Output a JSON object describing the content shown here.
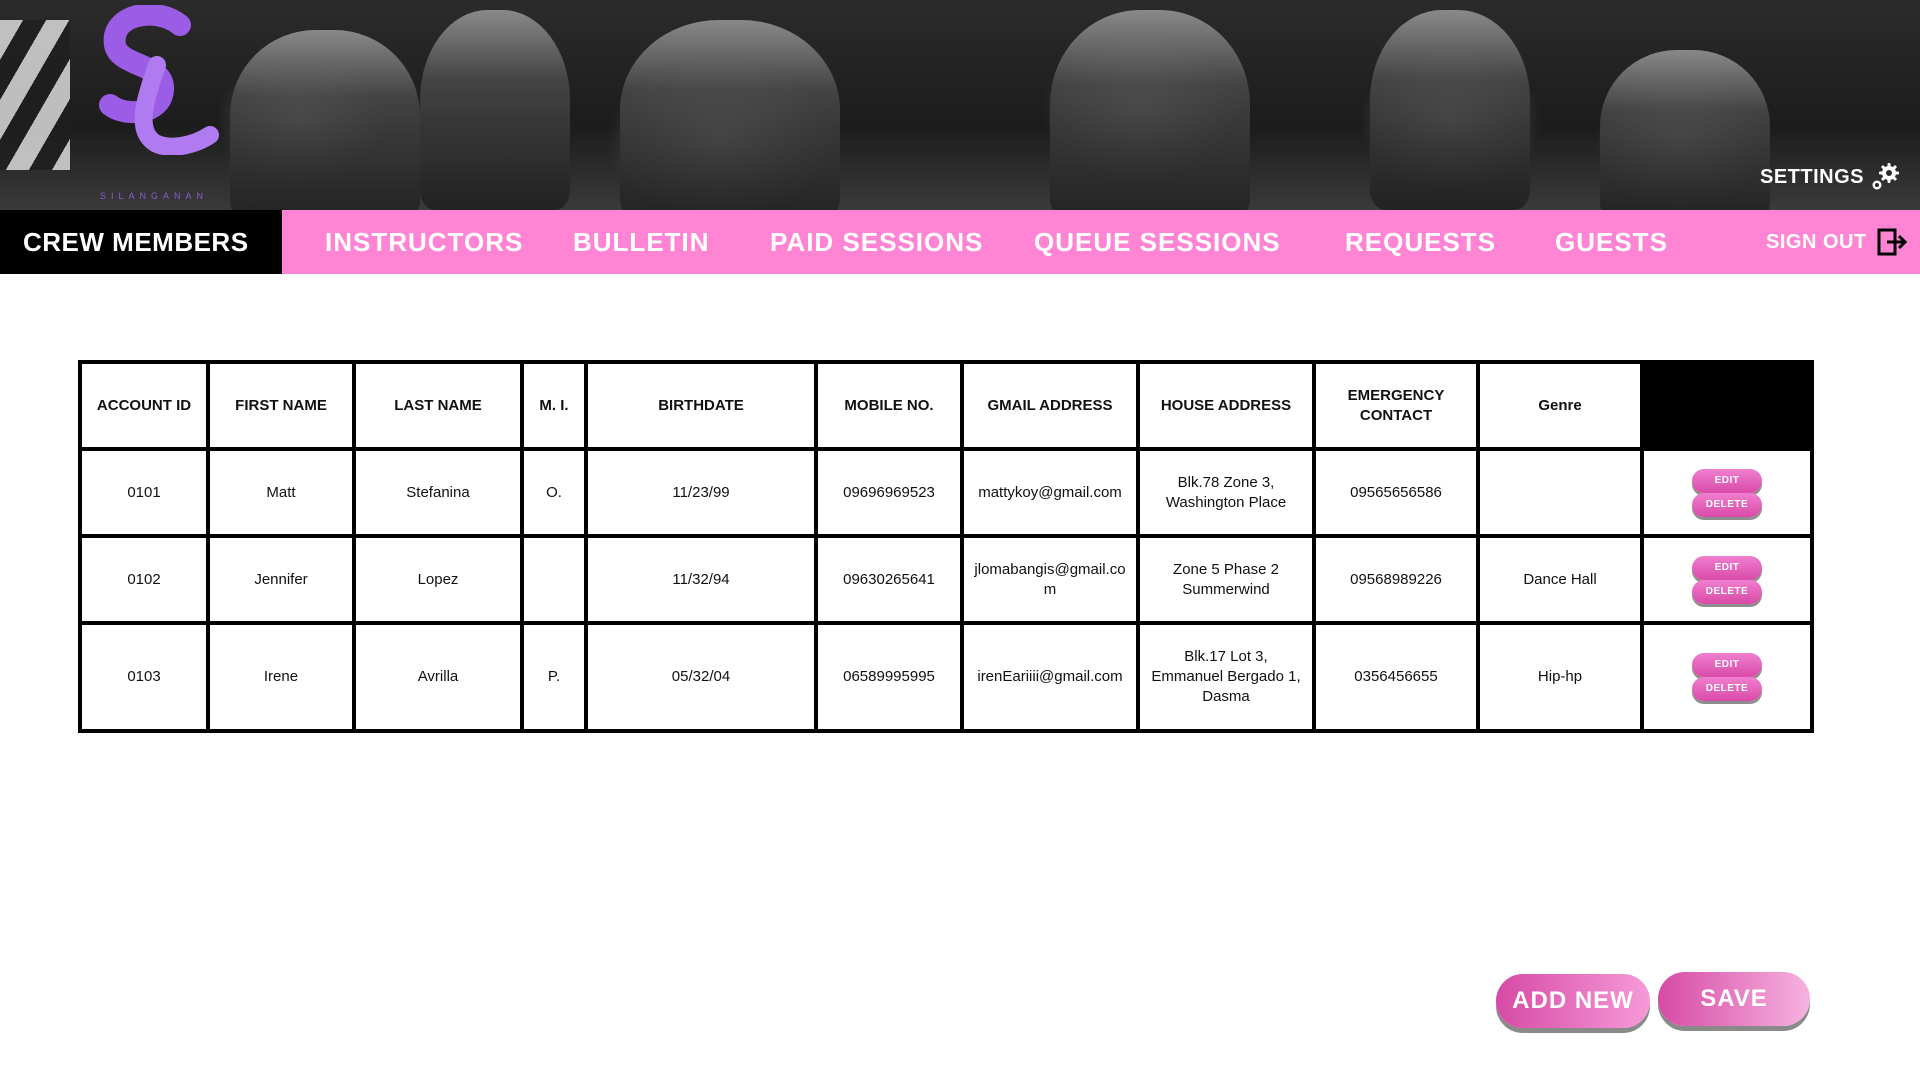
{
  "brand": {
    "logo_text": "SL",
    "caption": "SILANGANAN"
  },
  "header": {
    "settings_label": "SETTINGS"
  },
  "nav": {
    "active": "CREW MEMBERS",
    "items": [
      "INSTRUCTORS",
      "BULLETIN",
      "PAID SESSIONS",
      "QUEUE SESSIONS",
      "REQUESTS",
      "GUESTS"
    ],
    "sign_out": "SIGN OUT"
  },
  "table": {
    "headers": [
      "ACCOUNT ID",
      "FIRST NAME",
      "LAST NAME",
      "M. I.",
      "BIRTHDATE",
      "MOBILE NO.",
      "GMAIL ADDRESS",
      "HOUSE ADDRESS",
      "EMERGENCY CONTACT",
      "Genre"
    ],
    "rows": [
      [
        "0101",
        "Matt",
        "Stefanina",
        "O.",
        "11/23/99",
        "09696969523",
        "mattykoy@gmail.com",
        "Blk.78 Zone 3, Washington Place",
        "09565656586",
        ""
      ],
      [
        "0102",
        "Jennifer",
        "Lopez",
        "",
        "11/32/94",
        "09630265641",
        "jlomabangis@gmail.com",
        "Zone 5 Phase 2 Summerwind",
        "09568989226",
        "Dance Hall"
      ],
      [
        "0103",
        "Irene",
        "Avrilla",
        "P.",
        "05/32/04",
        "06589995995",
        "irenEariiii@gmail.com",
        "Blk.17 Lot 3, Emmanuel Bergado 1, Dasma",
        "0356456655",
        "Hip-hp"
      ]
    ],
    "edit_label": "EDIT",
    "delete_label": "DELETE"
  },
  "actions": {
    "add_new": "ADD NEW",
    "save": "SAVE"
  },
  "colors": {
    "nav_pink": "#ff85d4",
    "button_pink": "#d94aa8",
    "logo_purple": "#9b5de5"
  }
}
